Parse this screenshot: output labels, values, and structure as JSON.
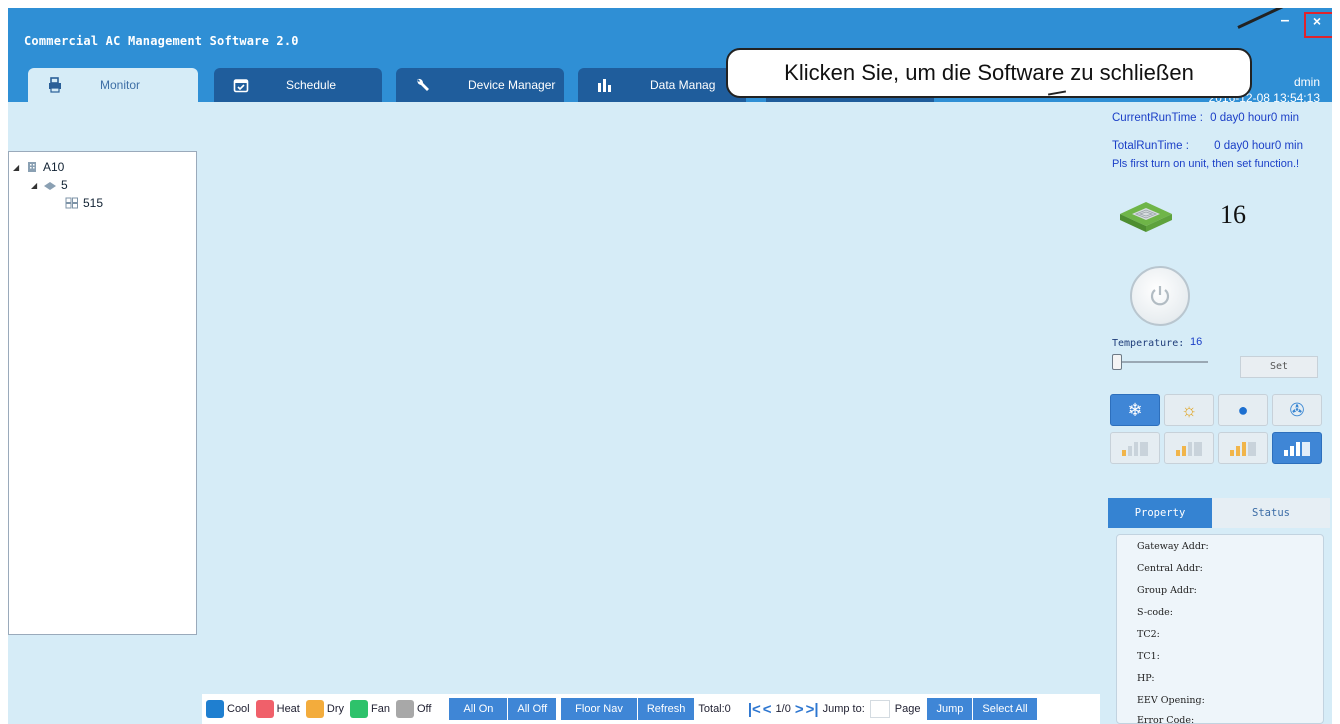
{
  "app": {
    "title": "Commercial AC Management Software 2.0",
    "minimize_glyph": "–",
    "close_glyph": "×"
  },
  "tabs": [
    {
      "label": "Monitor",
      "icon": "printer-icon"
    },
    {
      "label": "Schedule",
      "icon": "calendar-icon"
    },
    {
      "label": "Device Manager",
      "icon": "wrench-icon"
    },
    {
      "label": "Data Manag",
      "icon": "bar-chart-icon"
    }
  ],
  "user": {
    "name": "dmin",
    "datetime": "2016-12-08 13:54:13"
  },
  "callout": {
    "text": "Klicken Sie, um die Software zu schließen"
  },
  "tree": {
    "root": "A10",
    "floor": "5",
    "room": "515"
  },
  "side": {
    "current_run_label": "CurrentRunTime :",
    "current_run_value": "0 day0 hour0 min",
    "total_run_label": "TotalRunTime :",
    "total_run_value": "0 day0 hour0 min",
    "hint": "Pls first turn on unit, then set function.!",
    "unit_temp": "16",
    "temperature_label": "Temperature:",
    "temperature_value": "16",
    "set_label": "Set",
    "property_tab": "Property",
    "status_tab": "Status",
    "properties": [
      "Gateway Addr:",
      "Central Addr:",
      "Group Addr:",
      "S-code:",
      "TC2:",
      "TC1:",
      "HP:",
      "EEV Opening:",
      "Error Code:"
    ]
  },
  "bottom": {
    "legend": [
      {
        "label": "Cool",
        "color": "#1f7fd0"
      },
      {
        "label": "Heat",
        "color": "#f0606a"
      },
      {
        "label": "Dry",
        "color": "#f3ac3c"
      },
      {
        "label": "Fan",
        "color": "#2ec26b"
      },
      {
        "label": "Off",
        "color": "#a8a8a8"
      }
    ],
    "all_on": "All On",
    "all_off": "All Off",
    "floor_nav": "Floor Nav",
    "refresh": "Refresh",
    "total": "Total:0",
    "page_indicator": "1/0",
    "jump_to": "Jump to:",
    "page": "Page",
    "jump": "Jump",
    "select_all": "Select All"
  }
}
